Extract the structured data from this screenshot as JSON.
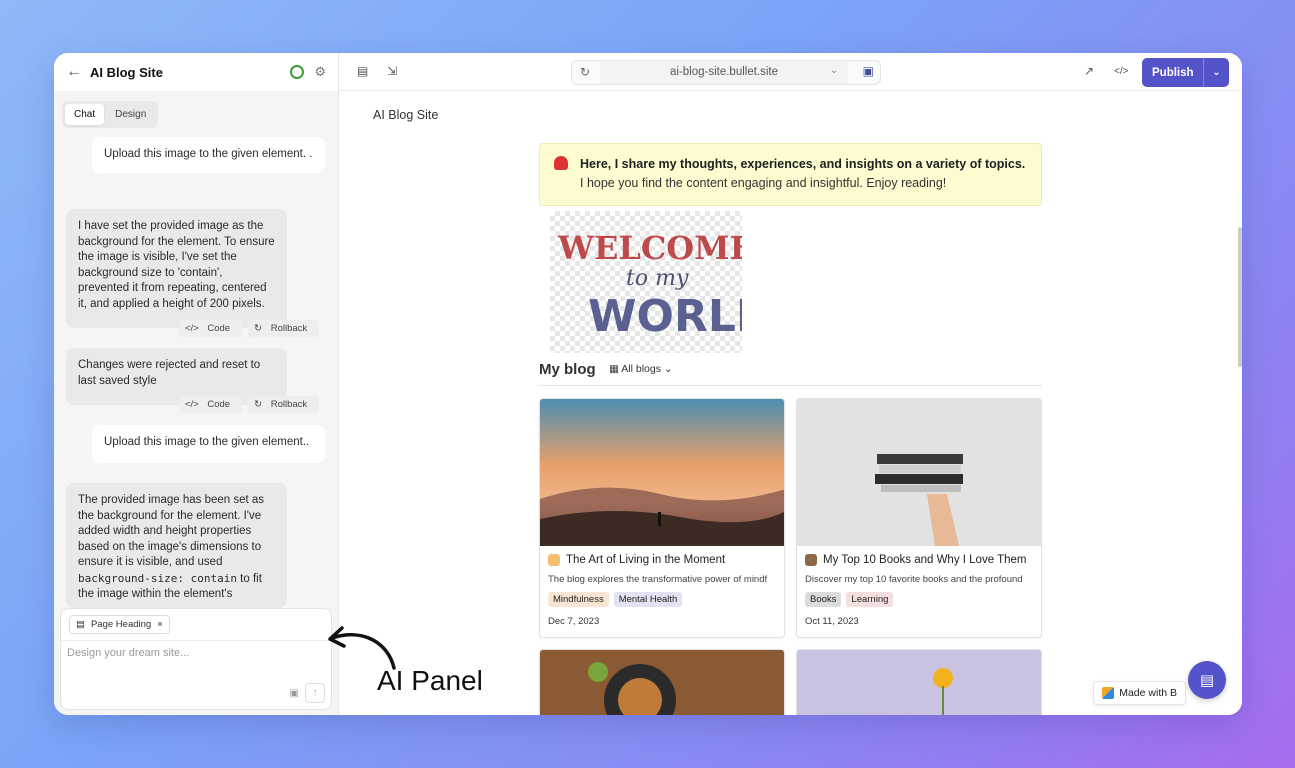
{
  "left": {
    "back_icon": "arrow-left-icon",
    "title": "AI Blog Site",
    "tabs": [
      "Chat",
      "Design"
    ],
    "messages": [
      {
        "role": "user",
        "text": "Upload this image to the given element. ."
      },
      {
        "role": "ai",
        "text": "I have set the provided image as the background for the element. To ensure the image is visible, I've set the background size to 'contain', prevented it from repeating, centered it, and applied a height of 200 pixels."
      },
      {
        "role": "ai",
        "text": "Changes were rejected and reset to last saved style"
      },
      {
        "role": "user",
        "text": "Upload this image to the given element.."
      },
      {
        "role": "ai",
        "text_a": "The provided image has been set as the background for the element. I've added width and height properties based on the image's dimensions to ensure it is visible, and used",
        "code": "background-size: contain",
        "text_b": "to fit the image within the element's"
      }
    ],
    "action_code": "Code",
    "action_rollback": "Rollback",
    "composer": {
      "chip": "Page Heading",
      "placeholder": "Design your dream site..."
    }
  },
  "topbar": {
    "url": "ai-blog-site.bullet.site",
    "publish": "Publish"
  },
  "site": {
    "title": "AI Blog Site",
    "callout_bold": "Here, I share my thoughts, experiences, and insights on a variety of topics.",
    "callout_rest": " I hope you find the content engaging and insightful. Enjoy reading!",
    "welcome_image": "welcome-to-my-world-graphic",
    "section_heading": "My blog",
    "filter_label": "All blogs",
    "cards": [
      {
        "title": "The Art of Living in the Moment",
        "desc": "The blog explores the transformative power of mindf",
        "tags": [
          "Mindfulness",
          "Mental Health"
        ],
        "date": "Dec 7, 2023"
      },
      {
        "title": "My Top 10 Books and Why I Love Them",
        "desc": "Discover my top 10 favorite books and the profound",
        "tags": [
          "Books",
          "Learning"
        ],
        "date": "Oct 11, 2023"
      }
    ],
    "made_with": "Made with B"
  },
  "annotation": {
    "label": "AI Panel"
  },
  "colors": {
    "accent": "#5553c9",
    "status": "#3a9b3a",
    "callout_bg": "#fdfbd0"
  }
}
